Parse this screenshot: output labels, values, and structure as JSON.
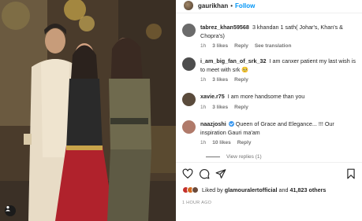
{
  "post": {
    "username": "gaurikhan",
    "follow_label": "Follow",
    "separator": "•"
  },
  "comments": [
    {
      "username": "tabrez_khan59568",
      "text": "3 khandan 1 sath( Johar's, Khan's & Chopra's)",
      "time": "1h",
      "likes": "3 likes",
      "reply": "Reply",
      "extra": "See translation",
      "avatar_color": "#6b6b6b"
    },
    {
      "username": "i_am_big_fan_of_srk_32",
      "text": "I am canxer patient my last wish is to meet with srk 🥺",
      "time": "1h",
      "likes": "3 likes",
      "reply": "Reply",
      "avatar_color": "#4d4d4d"
    },
    {
      "username": "xavie.r75",
      "text": "I am more handsome than you",
      "time": "1h",
      "likes": "3 likes",
      "reply": "Reply",
      "avatar_color": "#5a4b3c"
    },
    {
      "username": "naazjoshi",
      "verified": true,
      "text": "Queen of Grace and Elegance... !!! Our inspiration Gauri ma'am",
      "time": "1h",
      "likes": "10 likes",
      "reply": "Reply",
      "avatar_color": "#b07a6a"
    }
  ],
  "view_replies": "View replies (1)",
  "actions": {
    "icons": [
      "heart-icon",
      "comment-icon",
      "share-icon",
      "bookmark-icon"
    ]
  },
  "likes_summary": {
    "prefix": "Liked by",
    "user": "glamouralertofficial",
    "and": "and",
    "others": "41,823 others"
  },
  "timestamp": "1 HOUR AGO",
  "colors": {
    "link_blue": "#0095f6",
    "verified_blue": "#3897f0",
    "muted": "#737373"
  }
}
